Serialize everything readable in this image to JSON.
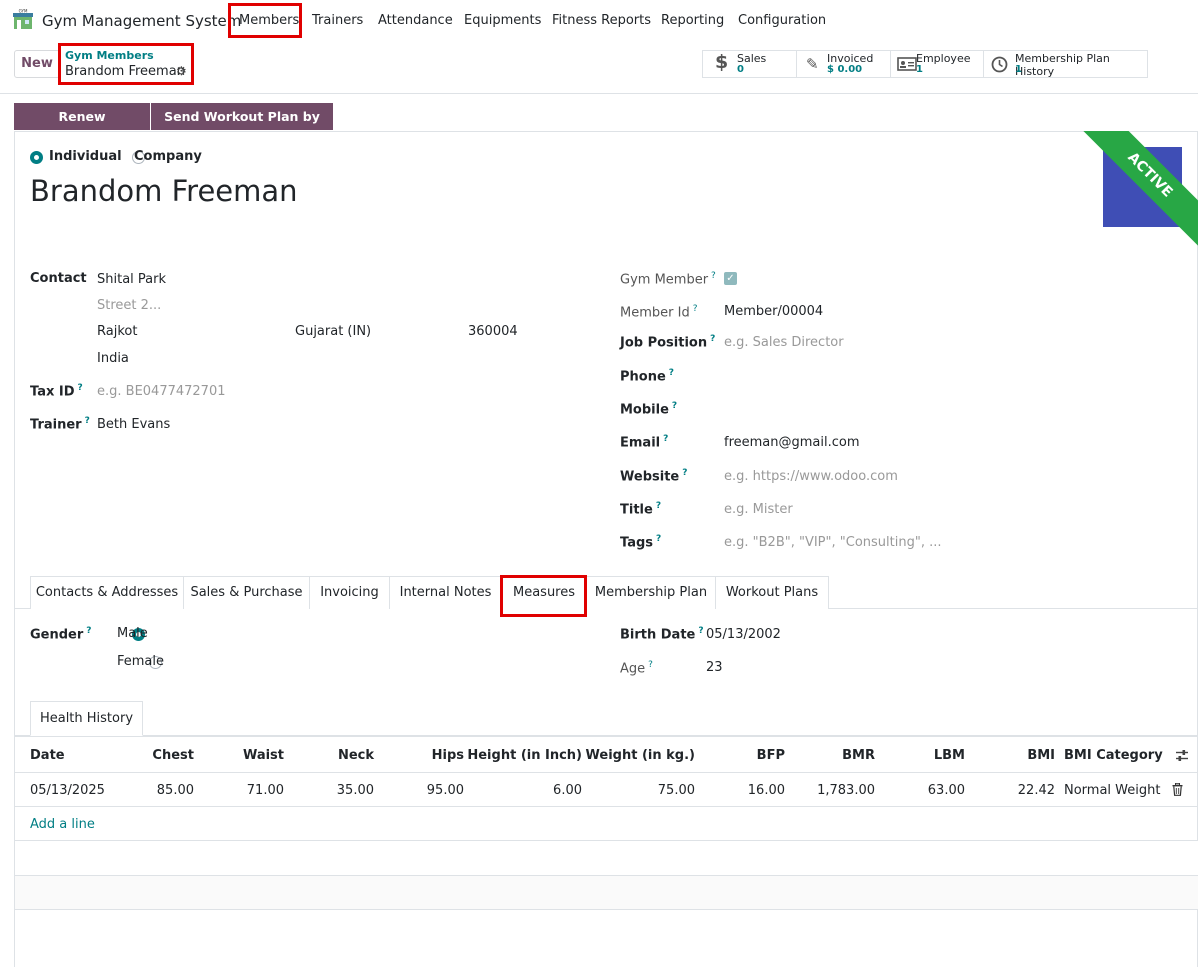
{
  "nav": {
    "app_name": "Gym Management System",
    "menu": [
      "Members",
      "Trainers",
      "Attendance",
      "Equipments",
      "Fitness Reports",
      "Reporting",
      "Configuration"
    ]
  },
  "control": {
    "new_label": "New",
    "breadcrumb_parent": "Gym Members",
    "breadcrumb_current": "Brandom Freeman"
  },
  "stats": [
    {
      "title": "Sales",
      "value": "0",
      "icon": "dollar-icon"
    },
    {
      "title": "Invoiced",
      "value": "$ 0.00",
      "icon": "edit-icon"
    },
    {
      "title": "Employee",
      "value": "1",
      "icon": "id-card-icon"
    },
    {
      "title": "Membership Plan History",
      "value": "1",
      "icon": "clock-icon"
    }
  ],
  "actions": {
    "renew": "Renew Membership",
    "send": "Send Workout Plan by Email"
  },
  "form": {
    "type_individual": "Individual",
    "type_company": "Company",
    "name": "Brandom Freeman",
    "ribbon": "ACTIVE",
    "contact_label": "Contact",
    "street": "Shital Park",
    "street2_placeholder": "Street 2...",
    "city": "Rajkot",
    "state": "Gujarat (IN)",
    "zip": "360004",
    "country": "India",
    "tax_label": "Tax ID",
    "tax_placeholder": "e.g. BE0477472701",
    "trainer_label": "Trainer",
    "trainer": "Beth Evans",
    "gym_member_label": "Gym Member",
    "gym_member_checked": true,
    "member_id_label": "Member Id",
    "member_id": "Member/00004",
    "job_label": "Job Position",
    "job_placeholder": "e.g. Sales Director",
    "phone_label": "Phone",
    "mobile_label": "Mobile",
    "email_label": "Email",
    "email": "freeman@gmail.com",
    "website_label": "Website",
    "website_placeholder": "e.g. https://www.odoo.com",
    "title_label": "Title",
    "title_placeholder": "e.g. Mister",
    "tags_label": "Tags",
    "tags_placeholder": "e.g. \"B2B\", \"VIP\", \"Consulting\", ..."
  },
  "tabs": [
    "Contacts & Addresses",
    "Sales & Purchase",
    "Invoicing",
    "Internal Notes",
    "Measures",
    "Membership Plan",
    "Workout Plans"
  ],
  "active_tab": "Measures",
  "measures": {
    "gender_label": "Gender",
    "male": "Male",
    "female": "Female",
    "gender_selected": "Male",
    "birth_label": "Birth Date",
    "birth": "05/13/2002",
    "age_label": "Age",
    "age": "23",
    "subtab": "Health History"
  },
  "table": {
    "columns": [
      "Date",
      "Chest",
      "Waist",
      "Neck",
      "Hips",
      "Height (in Inch)",
      "Weight (in kg.)",
      "BFP",
      "BMR",
      "LBM",
      "BMI",
      "BMI Category"
    ],
    "rows": [
      [
        "05/13/2025",
        "85.00",
        "71.00",
        "35.00",
        "95.00",
        "6.00",
        "75.00",
        "16.00",
        "1,783.00",
        "63.00",
        "22.42",
        "Normal Weight"
      ]
    ],
    "add_line": "Add a line"
  },
  "colors": {
    "brand": "#714b67",
    "accent": "#017e84",
    "ribbon": "#28a745",
    "highlight": "#e00000"
  }
}
